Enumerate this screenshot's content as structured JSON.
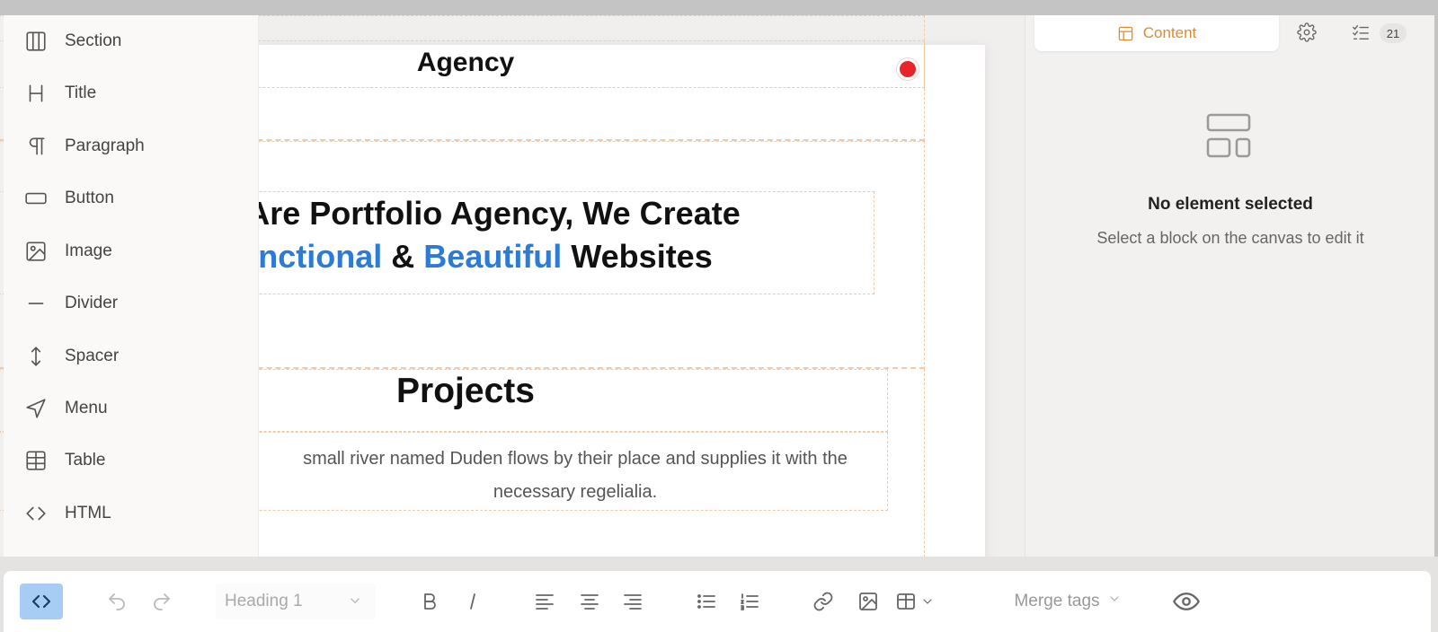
{
  "sidebar": {
    "items": [
      {
        "label": "Section",
        "icon": "columns-icon"
      },
      {
        "label": "Title",
        "icon": "heading-icon"
      },
      {
        "label": "Paragraph",
        "icon": "pilcrow-icon"
      },
      {
        "label": "Button",
        "icon": "button-icon"
      },
      {
        "label": "Image",
        "icon": "image-icon"
      },
      {
        "label": "Divider",
        "icon": "divider-icon"
      },
      {
        "label": "Spacer",
        "icon": "spacer-icon"
      },
      {
        "label": "Menu",
        "icon": "send-icon"
      },
      {
        "label": "Table",
        "icon": "table-icon"
      },
      {
        "label": "HTML",
        "icon": "code-icon"
      }
    ]
  },
  "canvas": {
    "header_title": "Agency",
    "hero": {
      "line1": "We Are Portfolio Agency, We Create",
      "word1": "Functional",
      "amp": "&",
      "word2": "Beautiful",
      "word3": "Websites"
    },
    "projects": {
      "title": "Projects",
      "text": "small river named Duden flows by their place and supplies it with the necessary regelialia."
    },
    "colors": {
      "highlight": "#2e7bd6",
      "indicator": "#e8262a"
    }
  },
  "right_panel": {
    "tab_content_label": "Content",
    "checklist_count": "21",
    "empty_title": "No element selected",
    "empty_subtitle": "Select a block on the canvas to edit it",
    "accent_color": "#e08a2e"
  },
  "toolbar": {
    "block_type": "Heading 1",
    "merge_tags_label": "Merge tags"
  }
}
